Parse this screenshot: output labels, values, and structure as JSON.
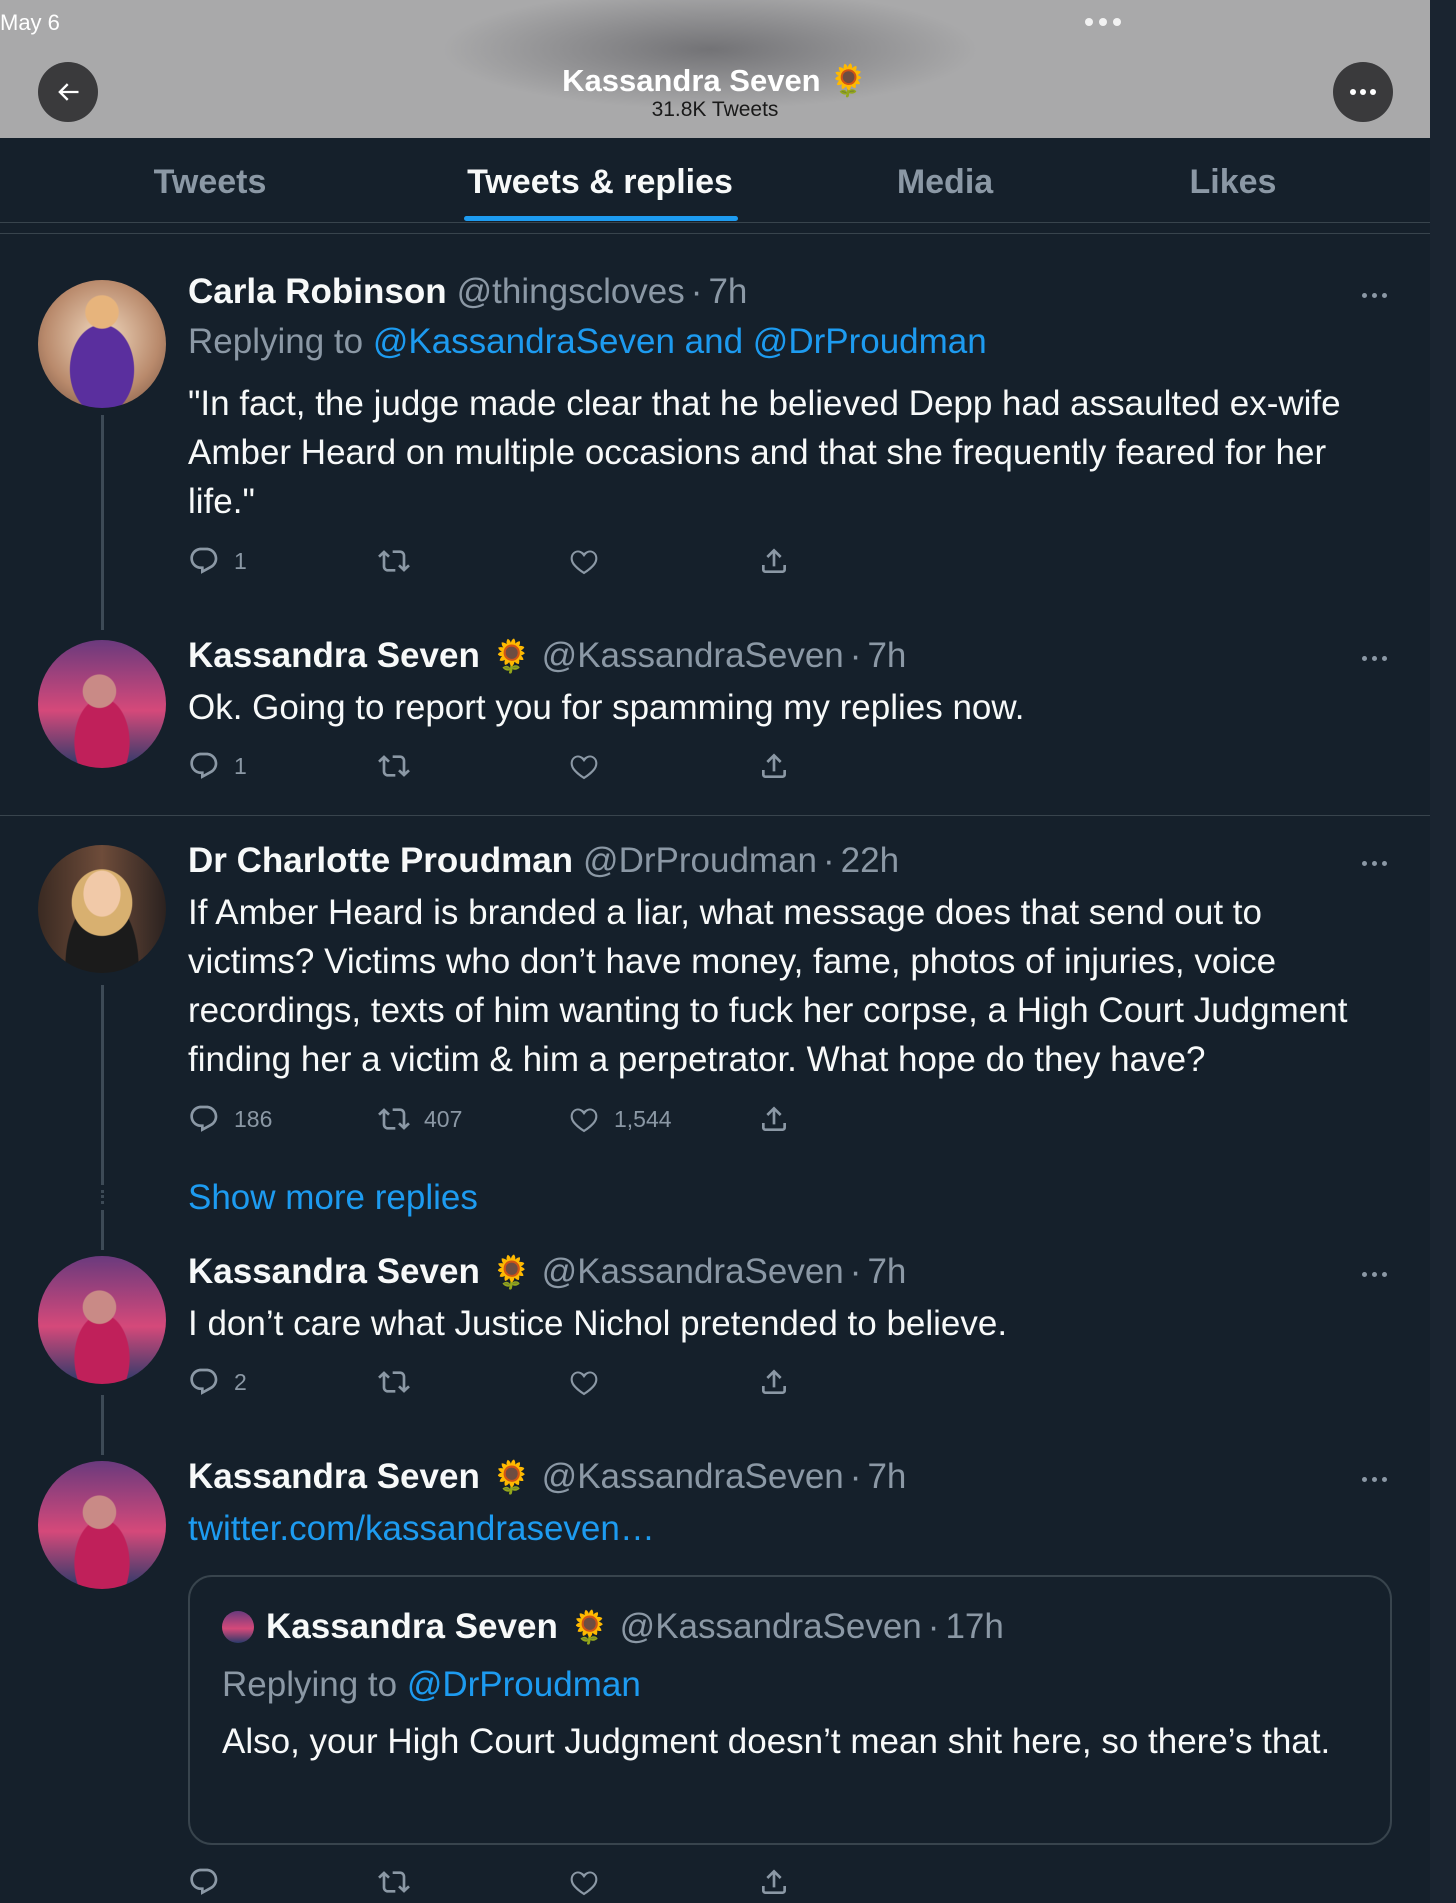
{
  "status_bar": {
    "date": "May 6"
  },
  "header": {
    "title": "Kassandra Seven",
    "title_emoji": "🌻",
    "subtitle": "31.8K Tweets"
  },
  "tabs": [
    {
      "label": "Tweets",
      "active": false
    },
    {
      "label": "Tweets & replies",
      "active": true
    },
    {
      "label": "Media",
      "active": false
    },
    {
      "label": "Likes",
      "active": false
    }
  ],
  "colors": {
    "background": "#15202b",
    "accent": "#1d9bf0",
    "muted": "#8b98a5",
    "divider": "#38444d"
  },
  "tweets": [
    {
      "name": "Carla Robinson",
      "handle": "@thingscloves",
      "sep": "·",
      "time": "7h",
      "replying_prefix": "Replying to",
      "replying_to": "@KassandraSeven and @DrProudman",
      "text": "\"In fact, the judge made clear that he believed Depp had assaulted ex-wife Amber Heard on multiple occasions and that she frequently feared for her life.\"",
      "replies": "1",
      "retweets": "",
      "likes": ""
    },
    {
      "name": "Kassandra Seven",
      "emoji": "🌻",
      "handle": "@KassandraSeven",
      "sep": "·",
      "time": "7h",
      "text": "Ok. Going to report you for spamming my replies now.",
      "replies": "1",
      "retweets": "",
      "likes": ""
    },
    {
      "name": "Dr Charlotte Proudman",
      "handle": "@DrProudman",
      "sep": "·",
      "time": "22h",
      "text": "If Amber Heard is branded a liar, what message does that send out to victims? Victims who don’t have money, fame, photos of injuries, voice recordings, texts of him wanting to fuck her corpse, a High Court Judgment finding her a victim & him a perpetrator. What hope do they have?",
      "replies": "186",
      "retweets": "407",
      "likes": "1,544"
    },
    {
      "name": "Kassandra Seven",
      "emoji": "🌻",
      "handle": "@KassandraSeven",
      "sep": "·",
      "time": "7h",
      "text": "I don’t care what Justice Nichol pretended to believe.",
      "replies": "2",
      "retweets": "",
      "likes": ""
    },
    {
      "name": "Kassandra Seven",
      "emoji": "🌻",
      "handle": "@KassandraSeven",
      "sep": "·",
      "time": "7h",
      "link": "twitter.com/kassandraseven…",
      "replies": "",
      "retweets": "",
      "likes": "",
      "quote": {
        "name": "Kassandra Seven",
        "emoji": "🌻",
        "handle": "@KassandraSeven",
        "sep": "·",
        "time": "17h",
        "replying_prefix": "Replying to",
        "replying_to": "@DrProudman",
        "text": "Also, your High Court Judgment doesn’t mean shit here, so there’s that."
      }
    }
  ],
  "show_more_replies": "Show more replies"
}
